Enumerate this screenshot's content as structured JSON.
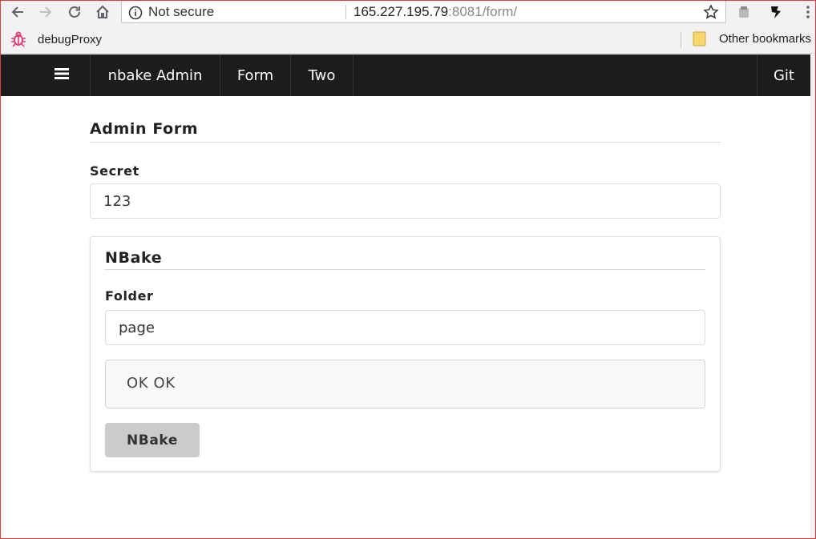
{
  "browser": {
    "security_label": "Not secure",
    "url_host": "165.227.195.79",
    "url_rest": ":8081/form/",
    "bookmarks": [
      {
        "label": "debugProxy"
      },
      {
        "label": "Other bookmarks"
      }
    ]
  },
  "navbar": {
    "items": [
      {
        "label": "nbake Admin"
      },
      {
        "label": "Form"
      },
      {
        "label": "Two"
      },
      {
        "label": "Git"
      }
    ]
  },
  "form": {
    "title": "Admin Form",
    "secret_label": "Secret",
    "secret_value": "123",
    "section": {
      "title": "NBake",
      "folder_label": "Folder",
      "folder_value": "page",
      "message": "OK OK",
      "button_label": "NBake"
    }
  },
  "colors": {
    "navbar_bg": "#1b1c1d",
    "button_bg": "#cacbcd",
    "message_bg": "#f8f8f8",
    "bookmark_icon": "#e0407a",
    "folder_icon": "#f5d76e"
  },
  "icons": [
    "back-icon",
    "forward-icon",
    "reload-icon",
    "home-icon",
    "info-icon",
    "star-icon",
    "extension-icon",
    "menu-dots-icon",
    "bug-icon",
    "folder-icon",
    "hamburger-icon"
  ]
}
